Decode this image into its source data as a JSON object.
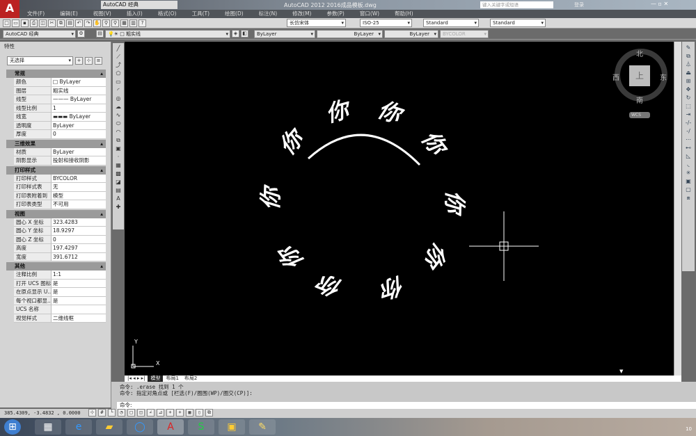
{
  "app": {
    "title": "AutoCAD 2012    2016成品模板.dwg",
    "workspace": "AutoCAD 经典",
    "search_placeholder": "键入关键字或短语",
    "login": "登录"
  },
  "menu": [
    "文件(F)",
    "编辑(E)",
    "视图(V)",
    "插入(I)",
    "格式(O)",
    "工具(T)",
    "绘图(D)",
    "标注(N)",
    "修改(M)",
    "参数(P)",
    "窗口(W)",
    "帮助(H)"
  ],
  "toolbar": {
    "text_style": "长仿宋体",
    "dim_style": "ISO-25",
    "table_style": "Standard",
    "mleader_style": "Standard",
    "workspace": "AutoCAD 经典",
    "layer": "粗实线",
    "color": "ByLayer",
    "linetype": "ByLayer",
    "lineweight": "ByLayer",
    "plotstyle": "BYCOLOR"
  },
  "palette": {
    "title": "特性",
    "selection": "无选择",
    "sections": [
      {
        "name": "常规",
        "rows": [
          [
            "颜色",
            "□ ByLayer"
          ],
          [
            "图层",
            "粗实线"
          ],
          [
            "线型",
            "——— ByLayer"
          ],
          [
            "线型比例",
            "1"
          ],
          [
            "线宽",
            "▬▬▬ ByLayer"
          ],
          [
            "透明度",
            "ByLayer"
          ],
          [
            "厚度",
            "0"
          ]
        ]
      },
      {
        "name": "三维效果",
        "rows": [
          [
            "材质",
            "ByLayer"
          ],
          [
            "阴影显示",
            "投射和接收阴影"
          ]
        ]
      },
      {
        "name": "打印样式",
        "rows": [
          [
            "打印样式",
            "BYCOLOR"
          ],
          [
            "打印样式表",
            "无"
          ],
          [
            "打印表附着到",
            "模型"
          ],
          [
            "打印表类型",
            "不可用"
          ]
        ]
      },
      {
        "name": "视图",
        "rows": [
          [
            "圆心 X 坐标",
            "323.4283"
          ],
          [
            "圆心 Y 坐标",
            "18.9297"
          ],
          [
            "圆心 Z 坐标",
            "0"
          ],
          [
            "高度",
            "197.4297"
          ],
          [
            "宽度",
            "391.6712"
          ]
        ]
      },
      {
        "name": "其他",
        "rows": [
          [
            "注释比例",
            "1:1"
          ],
          [
            "打开 UCS 图标",
            "是"
          ],
          [
            "在原点显示 U...",
            "是"
          ],
          [
            "每个视口都显...",
            "是"
          ],
          [
            "UCS 名称",
            ""
          ],
          [
            "视觉样式",
            "二维线框"
          ]
        ]
      }
    ]
  },
  "canvas": {
    "glyph": "你",
    "viewcube": {
      "north": "北",
      "south": "南",
      "east": "东",
      "west": "西",
      "top": "上",
      "ucs": "WCS"
    },
    "ucs_y": "Y",
    "ucs_x": "X"
  },
  "tabs": [
    "模型",
    "布局1",
    "布局2"
  ],
  "command": {
    "history": [
      "命令:  .erase 找到 1 个",
      "命令: 指定对角点或 [栏选(F)/圈围(WP)/圈交(CP)]:"
    ],
    "prompt": "命令:"
  },
  "status": {
    "coords": "385.4309, -3.4832 , 0.0000"
  },
  "taskbar": {
    "clock": "10"
  }
}
